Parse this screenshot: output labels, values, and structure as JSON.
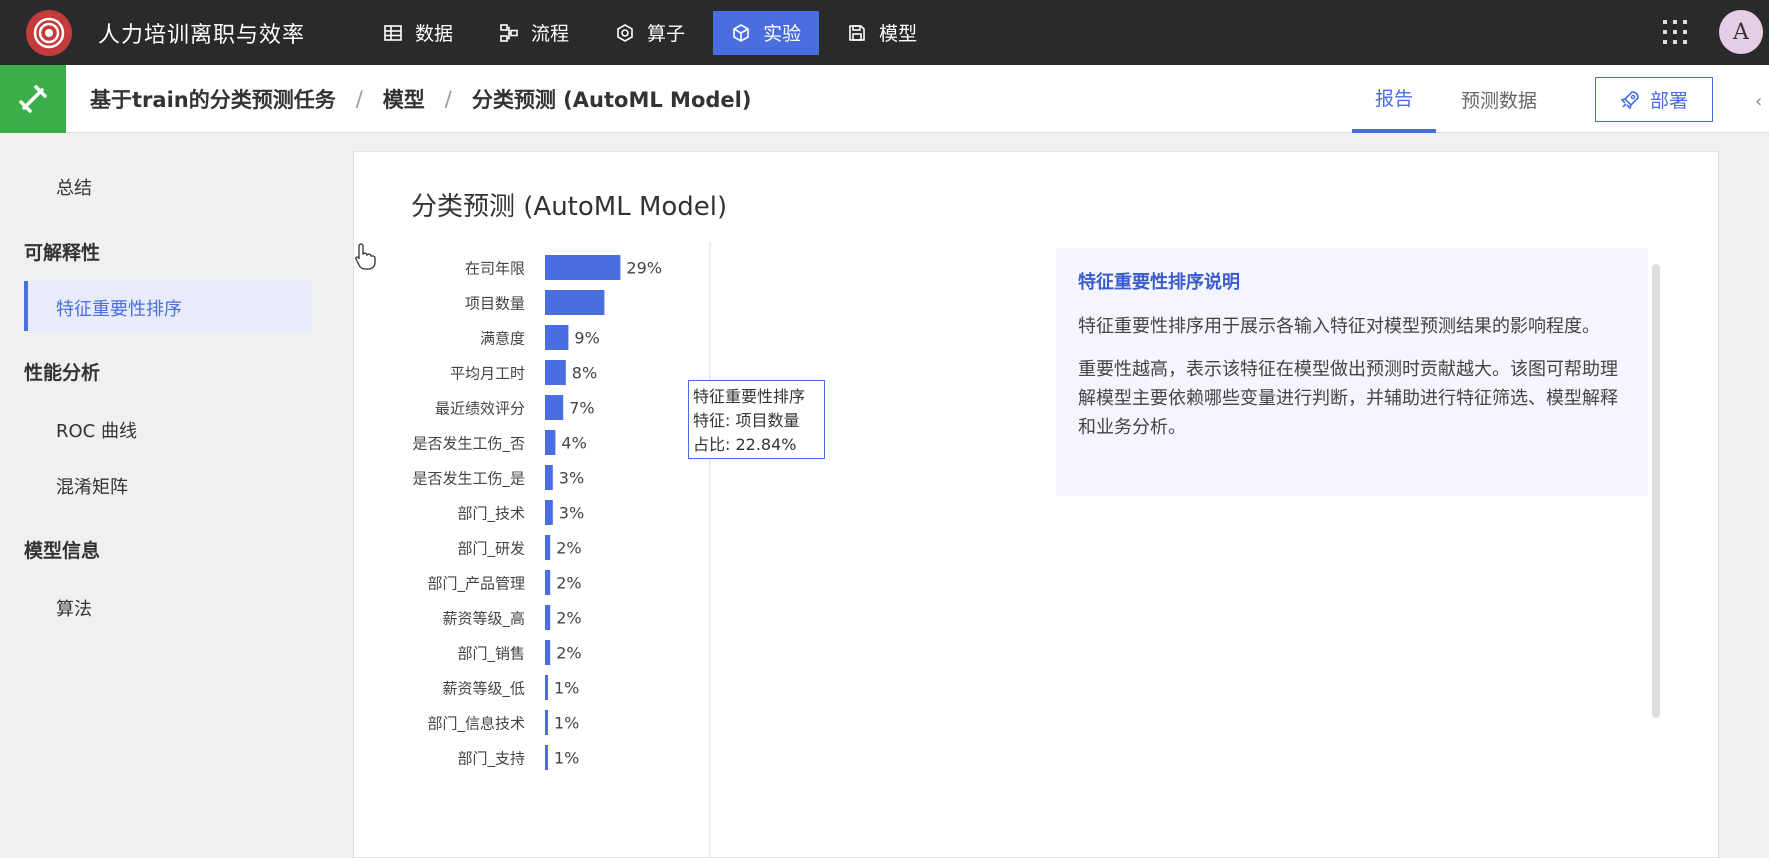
{
  "app": {
    "title": "人力培训离职与效率",
    "avatar_letter": "A"
  },
  "nav": {
    "items": [
      {
        "label": "数据",
        "icon": "table-icon"
      },
      {
        "label": "流程",
        "icon": "flow-icon"
      },
      {
        "label": "算子",
        "icon": "operator-icon"
      },
      {
        "label": "实验",
        "icon": "cube-icon",
        "active": true
      },
      {
        "label": "模型",
        "icon": "save-icon"
      }
    ]
  },
  "breadcrumb": {
    "items": [
      "基于train的分类预测任务",
      "模型",
      "分类预测 (AutoML Model)"
    ],
    "separator": "/"
  },
  "tabs": {
    "report": "报告",
    "predict": "预测数据"
  },
  "deploy_label": "部署",
  "sidebar": {
    "summary": "总结",
    "group_explain": "可解释性",
    "feature_importance": "特征重要性排序",
    "group_perf": "性能分析",
    "roc": "ROC 曲线",
    "confusion": "混淆矩阵",
    "group_model": "模型信息",
    "algorithm": "算法"
  },
  "main": {
    "title": "分类预测 (AutoML Model)"
  },
  "tooltip": {
    "line1": "特征重要性排序",
    "line2": "特征: 项目数量",
    "line3": "占比: 22.84%"
  },
  "info": {
    "title": "特征重要性排序说明",
    "p1": "特征重要性排序用于展示各输入特征对模型预测结果的影响程度。",
    "p2": "重要性越高，表示该特征在模型做出预测时贡献越大。该图可帮助理解模型主要依赖哪些变量进行判断，并辅助进行特征筛选、模型解释和业务分析。"
  },
  "colors": {
    "accent": "#4a6ee0",
    "bar": "#4a6ee0",
    "green": "#3cae4a"
  },
  "chart_data": {
    "type": "bar",
    "orientation": "horizontal",
    "categories": [
      "在司年限",
      "项目数量",
      "满意度",
      "平均月工时",
      "最近绩效评分",
      "是否发生工伤_否",
      "是否发生工伤_是",
      "部门_技术",
      "部门_研发",
      "部门_产品管理",
      "薪资等级_高",
      "部门_销售",
      "薪资等级_低",
      "部门_信息技术",
      "部门_支持"
    ],
    "values": [
      29,
      22.84,
      9,
      8,
      7,
      4,
      3,
      3,
      2,
      2,
      2,
      2,
      1,
      1,
      1
    ],
    "value_labels": [
      "29%",
      "",
      "9%",
      "8%",
      "7%",
      "4%",
      "3%",
      "3%",
      "2%",
      "2%",
      "2%",
      "2%",
      "1%",
      "1%",
      "1%"
    ],
    "title": "",
    "xlabel": "",
    "ylabel": ""
  }
}
